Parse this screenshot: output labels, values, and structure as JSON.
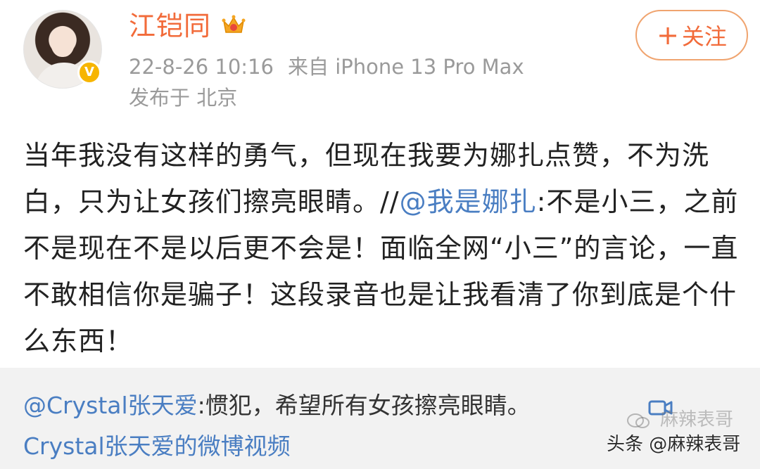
{
  "post": {
    "username": "江铠同",
    "verified_badge": "V",
    "crown_icon": "crown-icon",
    "timestamp": "22-8-26 10:16",
    "source": "来自 iPhone 13 Pro Max",
    "location": "发布于 北京",
    "follow_button": {
      "icon": "+",
      "label": "关注"
    },
    "text_part1": "当年我没有这样的勇气，但现在我要为娜扎点赞，不为洗白，只为让女孩们擦亮眼睛。//",
    "mention": "@我是娜扎",
    "text_part2": ":不是小三，之前不是现在不是以后更不会是！面临全网“小三”的言论，一直不敢相信你是骗子！这段录音也是让我看清了你到底是个什么东西！"
  },
  "repost": {
    "author": "@Crystal张天爱",
    "text": ":惯犯，希望所有女孩擦亮眼睛。",
    "video_icon": "video-camera-icon",
    "video_link": "Crystal张天爱的微博视频"
  },
  "watermark": {
    "faint_text": "麻辣表哥",
    "main_text": "头条 @麻辣表哥"
  },
  "colors": {
    "username": "#f26b3a",
    "link": "#4a7ec2",
    "meta": "#9a9a9a",
    "repost_bg": "#f2f2f2",
    "follow_border": "#f0a46f"
  }
}
